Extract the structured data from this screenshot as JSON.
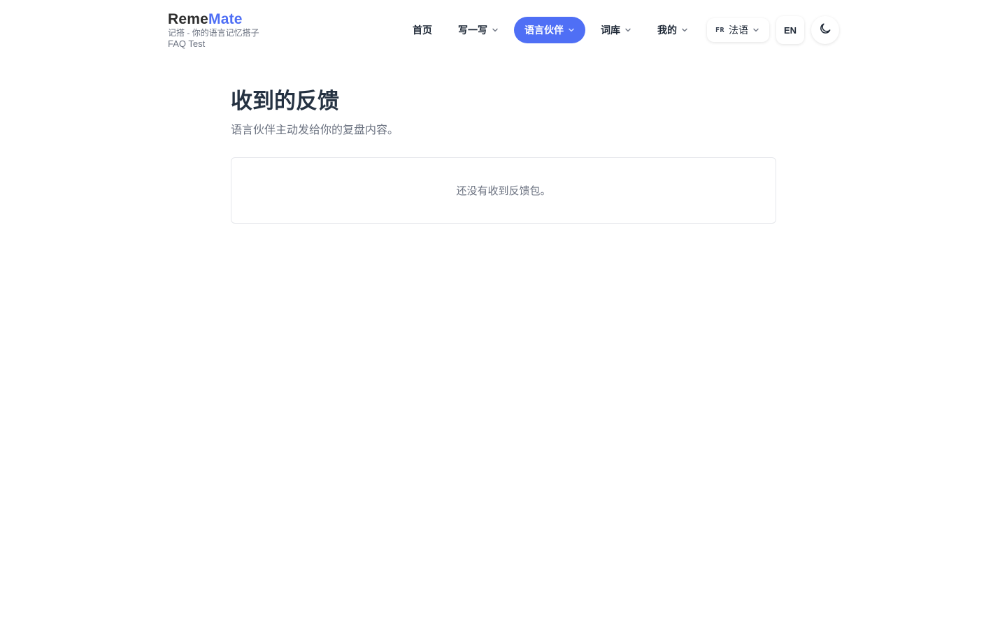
{
  "brand": {
    "name_part1": "Reme",
    "name_part2": "Mate",
    "tagline": "记搭 - 你的语言记忆搭子",
    "user": "FAQ Test"
  },
  "nav": {
    "items": [
      {
        "label": "首页",
        "has_dropdown": false,
        "active": false
      },
      {
        "label": "写一写",
        "has_dropdown": true,
        "active": false
      },
      {
        "label": "语言伙伴",
        "has_dropdown": true,
        "active": true
      },
      {
        "label": "词库",
        "has_dropdown": true,
        "active": false
      },
      {
        "label": "我的",
        "has_dropdown": true,
        "active": false
      }
    ],
    "language": {
      "code": "FR",
      "label": "法语"
    },
    "ui_language": "EN",
    "theme_icon": "moon-icon"
  },
  "page": {
    "title": "收到的反馈",
    "description": "语言伙伴主动发给你的复盘内容。",
    "empty_message": "还没有收到反馈包。"
  },
  "colors": {
    "accent": "#4f6ff5",
    "text": "#1f2937",
    "muted": "#6b7280",
    "border": "#e5e7eb"
  }
}
